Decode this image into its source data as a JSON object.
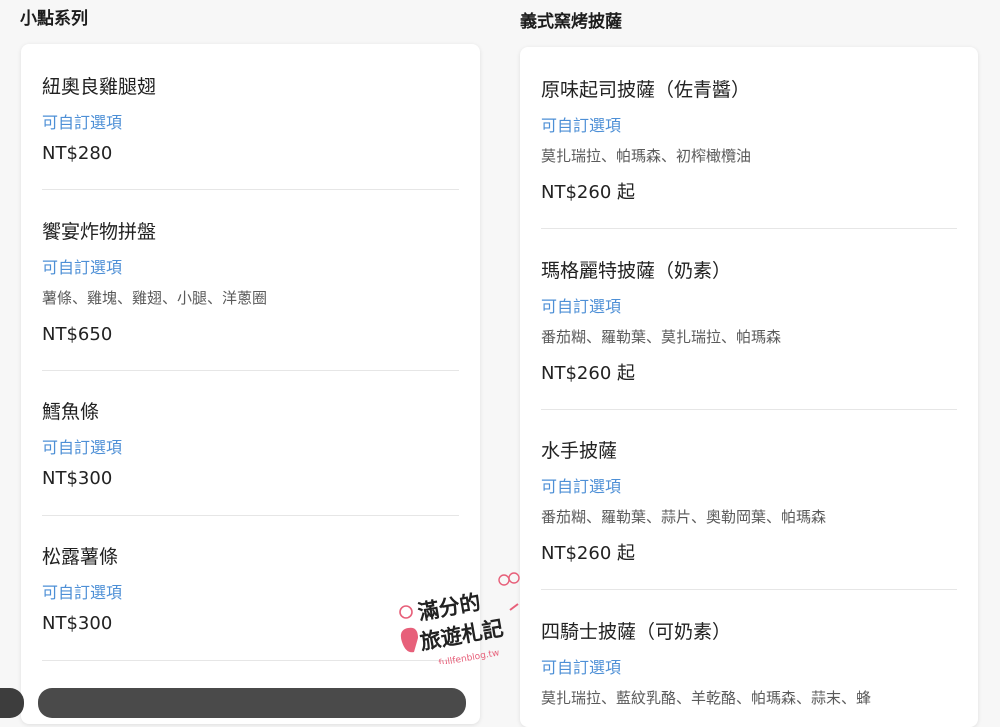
{
  "sections": {
    "snacks": {
      "title": "小點系列",
      "items": [
        {
          "name": "紐奧良雞腿翅",
          "option": "可自訂選項",
          "price": "NT$280"
        },
        {
          "name": "饗宴炸物拼盤",
          "option": "可自訂選項",
          "desc": "薯條、雞塊、雞翅、小腿、洋蔥圈",
          "price": "NT$650"
        },
        {
          "name": "鱈魚條",
          "option": "可自訂選項",
          "price": "NT$300"
        },
        {
          "name": "松露薯條",
          "option": "可自訂選項",
          "price": "NT$300"
        }
      ]
    },
    "pizza": {
      "title": "義式窯烤披薩",
      "items": [
        {
          "name": "原味起司披薩（佐青醬）",
          "option": "可自訂選項",
          "desc": "莫扎瑞拉、帕瑪森、初榨橄欖油",
          "price": "NT$260 起"
        },
        {
          "name": "瑪格麗特披薩（奶素）",
          "option": "可自訂選項",
          "desc": "番茄糊、羅勒葉、莫扎瑞拉、帕瑪森",
          "price": "NT$260 起"
        },
        {
          "name": "水手披薩",
          "option": "可自訂選項",
          "desc": "番茄糊、羅勒葉、蒜片、奧勒岡葉、帕瑪森",
          "price": "NT$260 起"
        },
        {
          "name": "四騎士披薩（可奶素）",
          "option": "可自訂選項",
          "desc": "莫扎瑞拉、藍紋乳酪、羊乾酪、帕瑪森、蒜末、蜂"
        }
      ]
    }
  },
  "watermark": {
    "line1": "滿分的",
    "line2": "旅遊札記",
    "url": "fullfenblog.tw"
  },
  "colors": {
    "accent": "#4d8fd6",
    "card_bg": "#ffffff",
    "page_bg": "#f7f7f7"
  }
}
